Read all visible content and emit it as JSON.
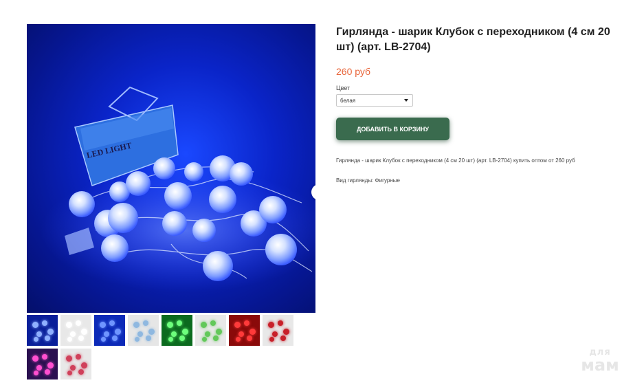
{
  "product": {
    "title": "Гирлянда - шарик Клубок с переходником (4 см 20 шт) (арт. LB-2704)",
    "price": "260 руб",
    "color_label": "Цвет",
    "color_value": "белая",
    "add_to_cart": "ДОБАВИТЬ В КОРЗИНУ",
    "description": "Гирлянда - шарик Клубок с переходником (4 см 20 шт) (арт. LB-2704) купить оптом от 260 руб",
    "attribute": "Вид гирлянды: Фигурные"
  },
  "gallery": {
    "package_text": "LED LIGHT",
    "thumbnails": [
      {
        "name": "blue-dark",
        "bg": "#0a1f9a",
        "dot": "#8fb0ff"
      },
      {
        "name": "white",
        "bg": "#e8e8e8",
        "dot": "#ffffff"
      },
      {
        "name": "blue",
        "bg": "#0c2ab8",
        "dot": "#6f95ff"
      },
      {
        "name": "light-blue",
        "bg": "#e6e6e6",
        "dot": "#8fb8e0"
      },
      {
        "name": "green-dark",
        "bg": "#0b6a1e",
        "dot": "#6dff7c"
      },
      {
        "name": "green",
        "bg": "#e8e8e8",
        "dot": "#63c85a"
      },
      {
        "name": "red-dark",
        "bg": "#8a0a0a",
        "dot": "#ff3a3a"
      },
      {
        "name": "red",
        "bg": "#e8e8e8",
        "dot": "#c8202a"
      },
      {
        "name": "multicolor-dark",
        "bg": "#2a1050",
        "dot": "#ff4fd0"
      },
      {
        "name": "multicolor",
        "bg": "#e8e8e8",
        "dot": "#d0405a"
      }
    ]
  },
  "watermark": {
    "line1": "для",
    "line2": "мам"
  },
  "colors": {
    "price": "#e8653a",
    "button": "#3a6b4e"
  }
}
